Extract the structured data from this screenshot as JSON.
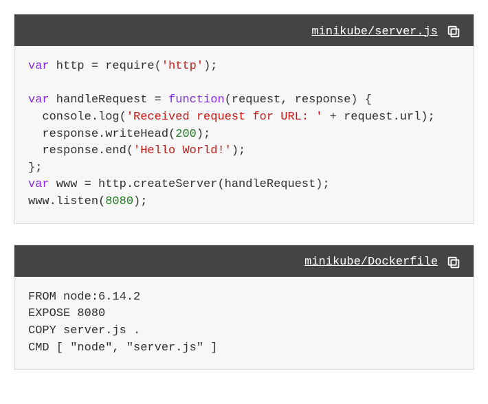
{
  "blocks": [
    {
      "filename": "minikube/server.js",
      "tokens": [
        {
          "t": "var",
          "c": "kw"
        },
        {
          "t": " http = require(",
          "c": "plain"
        },
        {
          "t": "'http'",
          "c": "str"
        },
        {
          "t": ");",
          "c": "plain"
        },
        {
          "t": "\n",
          "c": "plain"
        },
        {
          "t": "\n",
          "c": "plain"
        },
        {
          "t": "var",
          "c": "kw"
        },
        {
          "t": " handleRequest = ",
          "c": "plain"
        },
        {
          "t": "function",
          "c": "fn"
        },
        {
          "t": "(request, response) {",
          "c": "plain"
        },
        {
          "t": "\n",
          "c": "plain"
        },
        {
          "t": "  console.log(",
          "c": "plain"
        },
        {
          "t": "'Received request for URL: '",
          "c": "str"
        },
        {
          "t": " + request.url);",
          "c": "plain"
        },
        {
          "t": "\n",
          "c": "plain"
        },
        {
          "t": "  response.writeHead(",
          "c": "plain"
        },
        {
          "t": "200",
          "c": "num"
        },
        {
          "t": ");",
          "c": "plain"
        },
        {
          "t": "\n",
          "c": "plain"
        },
        {
          "t": "  response.end(",
          "c": "plain"
        },
        {
          "t": "'Hello World!'",
          "c": "str"
        },
        {
          "t": ");",
          "c": "plain"
        },
        {
          "t": "\n",
          "c": "plain"
        },
        {
          "t": "};",
          "c": "plain"
        },
        {
          "t": "\n",
          "c": "plain"
        },
        {
          "t": "var",
          "c": "kw"
        },
        {
          "t": " www = http.createServer(handleRequest);",
          "c": "plain"
        },
        {
          "t": "\n",
          "c": "plain"
        },
        {
          "t": "www.listen(",
          "c": "plain"
        },
        {
          "t": "8080",
          "c": "num"
        },
        {
          "t": ");",
          "c": "plain"
        }
      ]
    },
    {
      "filename": "minikube/Dockerfile",
      "tokens": [
        {
          "t": "FROM node:6.14.2\nEXPOSE 8080\nCOPY server.js .\nCMD [ \"node\", \"server.js\" ]",
          "c": "plain"
        }
      ]
    }
  ]
}
